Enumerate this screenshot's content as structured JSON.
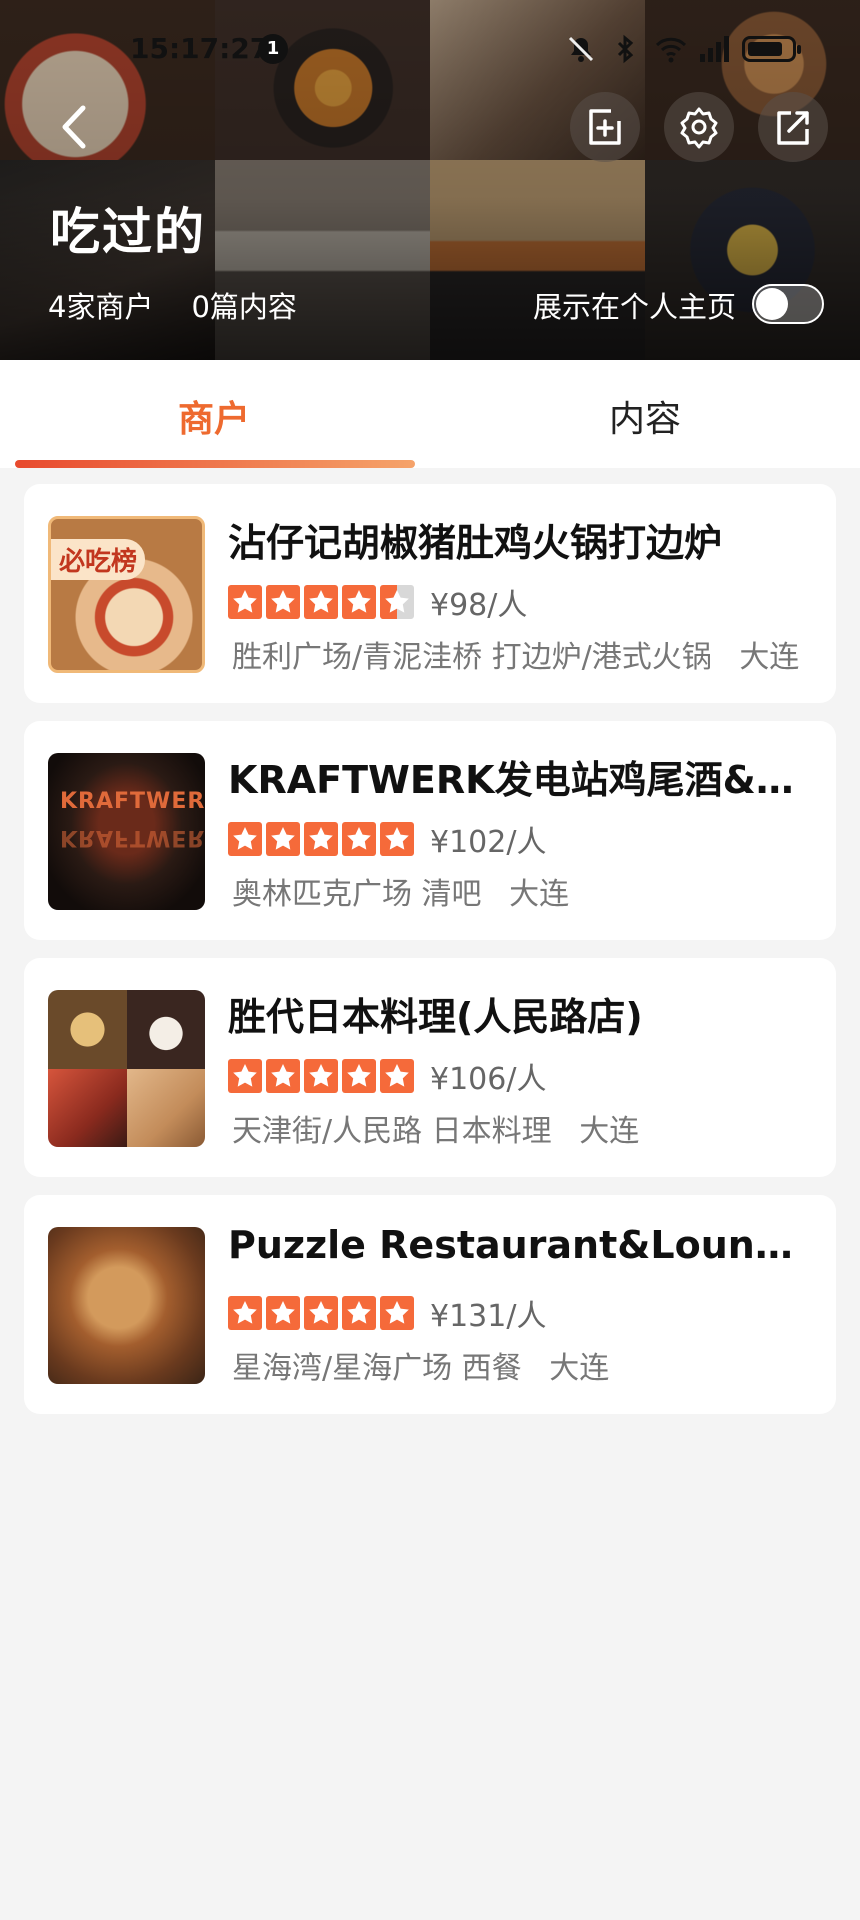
{
  "status_bar": {
    "time": "15:17:27",
    "notification_count": "1"
  },
  "header": {
    "title": "吃过的",
    "merchant_count": "4家商户",
    "content_count": "0篇内容",
    "show_on_profile_label": "展示在个人主页",
    "show_on_profile_enabled": false
  },
  "tabs": {
    "merchants": "商户",
    "content": "内容",
    "active": "merchants"
  },
  "merchants": [
    {
      "name": "沾仔记胡椒猪肚鸡火锅打边炉",
      "rating": 4.5,
      "price": "¥98/人",
      "area": "胜利广场/青泥洼桥",
      "category": "打边炉/港式火锅",
      "city": "大连",
      "badge": "必吃榜"
    },
    {
      "name": "KRAFTWERK发电站鸡尾酒&威...",
      "rating": 5,
      "price": "¥102/人",
      "area": "奥林匹克广场",
      "category": "清吧",
      "city": "大连",
      "thumb_text": "KRAFTWERK"
    },
    {
      "name": "胜代日本料理(人民路店)",
      "rating": 5,
      "price": "¥106/人",
      "area": "天津街/人民路",
      "category": "日本料理",
      "city": "大连"
    },
    {
      "name": "Puzzle Restaurant&Lounge ...",
      "rating": 5,
      "price": "¥131/人",
      "area": "星海湾/星海广场",
      "category": "西餐",
      "city": "大连"
    }
  ],
  "colors": {
    "accent": "#ee6a2f",
    "star": "#f56a3a",
    "background": "#f4f4f4"
  },
  "icons": [
    "back-icon",
    "add-to-list-icon",
    "settings-icon",
    "share-icon",
    "star-icon"
  ]
}
